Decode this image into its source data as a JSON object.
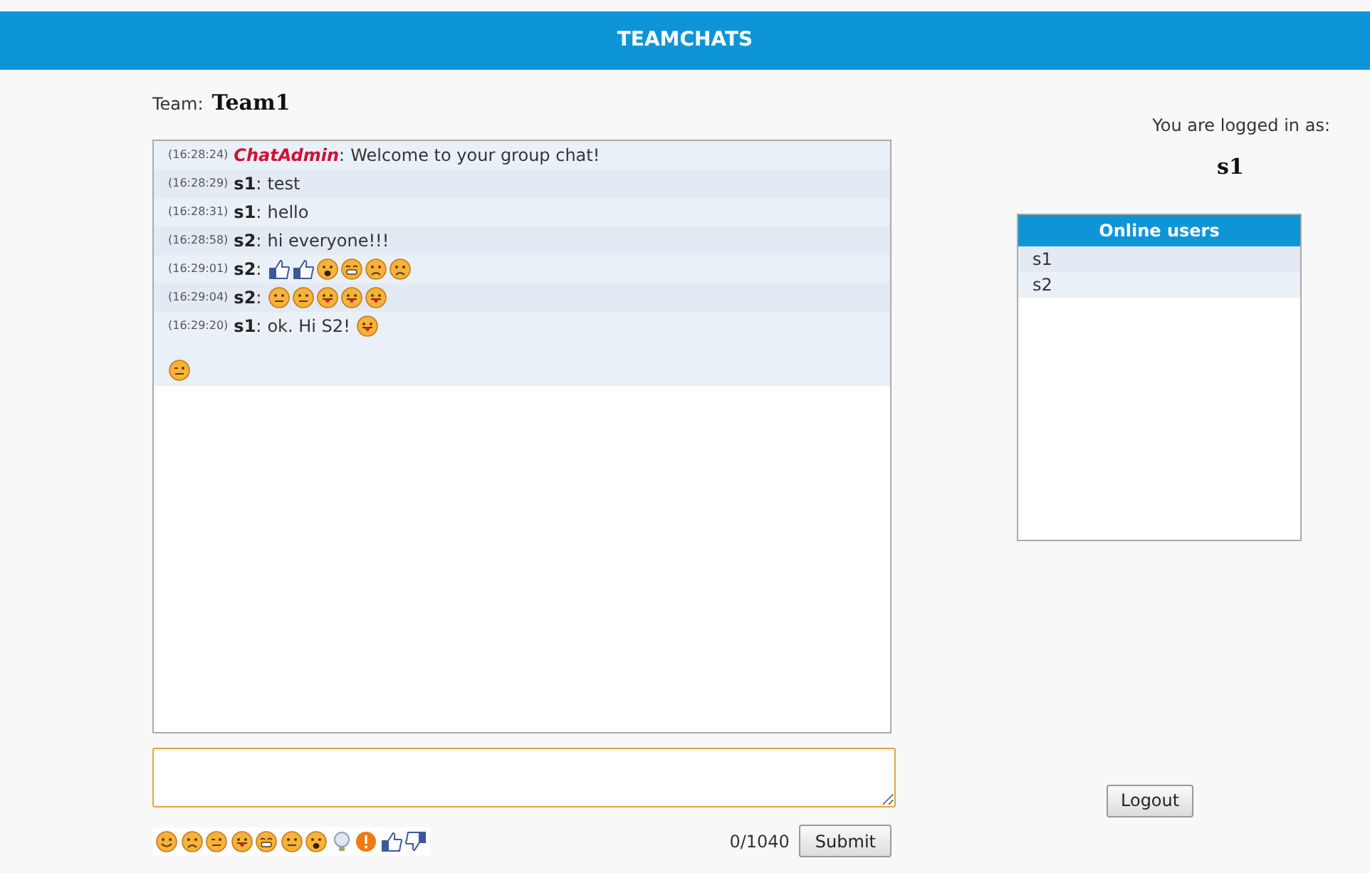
{
  "header": {
    "title": "TEAMCHATS"
  },
  "team": {
    "label": "Team:",
    "name": "Team1"
  },
  "messages": [
    {
      "time": "(16:28:24)",
      "user": "ChatAdmin",
      "separator": ":",
      "kind": "admin",
      "text": "Welcome to your group chat!"
    },
    {
      "time": "(16:28:29)",
      "user": "s1",
      "separator": ":",
      "kind": "user",
      "text": "test"
    },
    {
      "time": "(16:28:31)",
      "user": "s1",
      "separator": ":",
      "kind": "user",
      "text": "hello"
    },
    {
      "time": "(16:28:58)",
      "user": "s2",
      "separator": ":",
      "kind": "user",
      "text": "hi everyone!!!"
    },
    {
      "time": "(16:29:01)",
      "user": "s2",
      "separator": ":",
      "kind": "user",
      "emoticons": [
        {
          "kind": "thumbs-up"
        },
        {
          "kind": "thumbs-up"
        },
        {
          "kind": "shocked"
        },
        {
          "kind": "grin"
        },
        {
          "kind": "sad"
        },
        {
          "kind": "sad"
        }
      ]
    },
    {
      "time": "(16:29:04)",
      "user": "s2",
      "separator": ":",
      "kind": "user",
      "emoticons": [
        {
          "kind": "neutral"
        },
        {
          "kind": "neutral"
        },
        {
          "kind": "tongue"
        },
        {
          "kind": "tongue"
        },
        {
          "kind": "tongue"
        }
      ]
    },
    {
      "time": "(16:29:20)",
      "user": "s1",
      "separator": ":",
      "kind": "user",
      "text": "ok. Hi S2!",
      "emoticons": [
        {
          "kind": "tongue"
        }
      ],
      "second_line": [
        {
          "kind": "wink"
        }
      ]
    }
  ],
  "composer": {
    "counter": "0/1040",
    "submit": "Submit",
    "emoticons": [
      {
        "kind": "smile"
      },
      {
        "kind": "sad"
      },
      {
        "kind": "wink"
      },
      {
        "kind": "tongue"
      },
      {
        "kind": "grin"
      },
      {
        "kind": "neutral"
      },
      {
        "kind": "shocked"
      },
      {
        "kind": "bulb"
      },
      {
        "kind": "alert"
      },
      {
        "kind": "thumbs-up"
      },
      {
        "kind": "thumbs-down"
      }
    ]
  },
  "login": {
    "label": "You are logged in as:",
    "user": "s1"
  },
  "online_users": {
    "title": "Online users",
    "users": [
      "s1",
      "s2"
    ]
  },
  "logout": "Logout"
}
